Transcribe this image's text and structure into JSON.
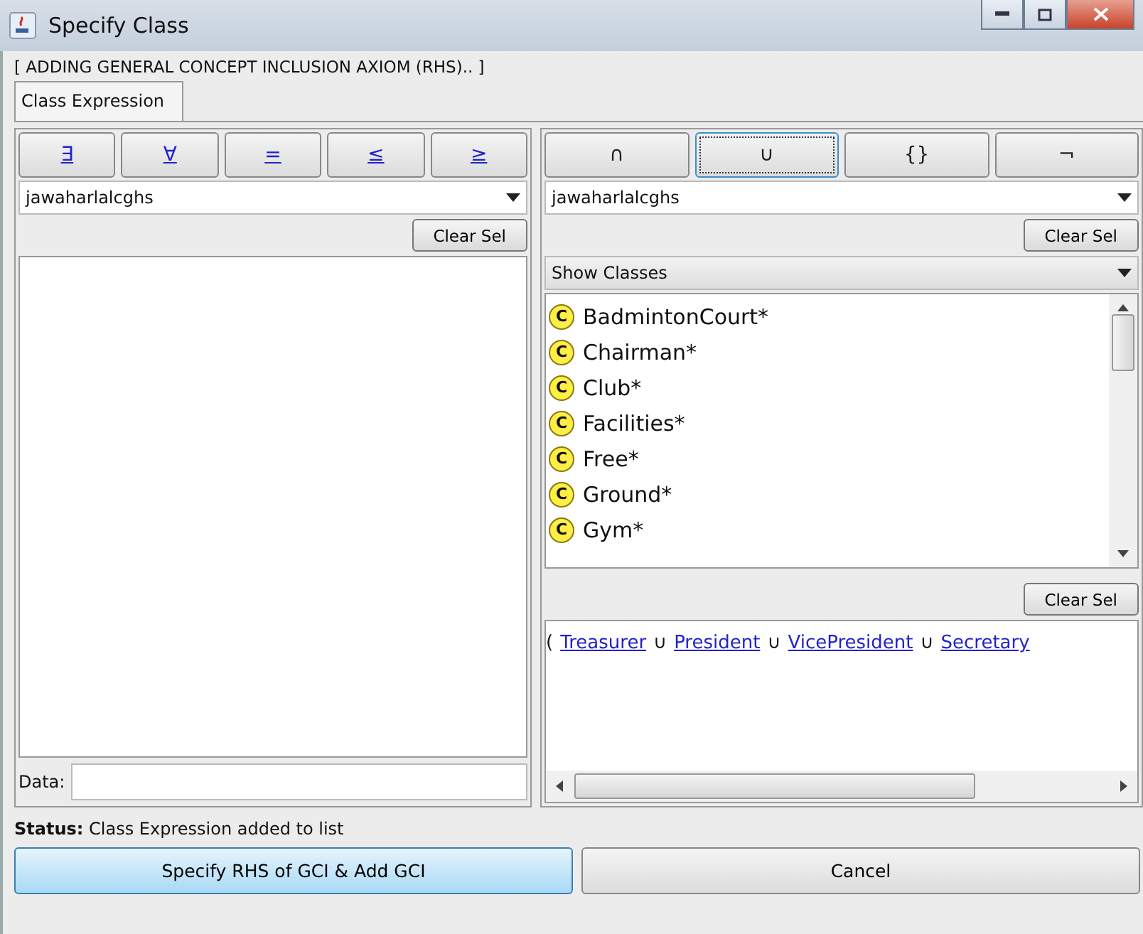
{
  "window": {
    "title": "Specify Class"
  },
  "header": "[ ADDING GENERAL CONCEPT INCLUSION AXIOM (RHS).. ]",
  "tabs": [
    {
      "label": "Class Expression",
      "selected": true
    }
  ],
  "left": {
    "operators": [
      {
        "symbol": "∃"
      },
      {
        "symbol": "∀"
      },
      {
        "symbol": "="
      },
      {
        "symbol": "≤"
      },
      {
        "symbol": "≥"
      }
    ],
    "ontology": "jawaharlalcghs",
    "clear": "Clear Sel",
    "data_label": "Data:"
  },
  "right": {
    "operators": [
      {
        "symbol": "∩",
        "focused": false
      },
      {
        "symbol": "∪",
        "focused": true
      },
      {
        "symbol": "{}",
        "focused": false
      },
      {
        "symbol": "¬",
        "focused": false
      }
    ],
    "ontology": "jawaharlalcghs",
    "clear": "Clear Sel",
    "filter": "Show Classes",
    "classes": [
      {
        "icon": "C",
        "name": "BadmintonCourt*"
      },
      {
        "icon": "C",
        "name": "Chairman*"
      },
      {
        "icon": "C",
        "name": "Club*"
      },
      {
        "icon": "C",
        "name": "Facilities*"
      },
      {
        "icon": "C",
        "name": "Free*"
      },
      {
        "icon": "C",
        "name": "Ground*"
      },
      {
        "icon": "C",
        "name": "Gym*"
      }
    ],
    "clear2": "Clear Sel",
    "expression": [
      {
        "kind": "text",
        "text": "("
      },
      {
        "kind": "link",
        "text": "Treasurer"
      },
      {
        "kind": "text",
        "text": "∪"
      },
      {
        "kind": "link",
        "text": "President"
      },
      {
        "kind": "text",
        "text": "∪"
      },
      {
        "kind": "link",
        "text": "VicePresident"
      },
      {
        "kind": "text",
        "text": "∪"
      },
      {
        "kind": "link",
        "text": "Secretary"
      }
    ]
  },
  "status": {
    "label": "Status:",
    "text": "Class Expression added to list"
  },
  "buttons": [
    {
      "label": "Specify RHS of GCI & Add GCI",
      "default": true
    },
    {
      "label": "Cancel",
      "default": false
    }
  ]
}
